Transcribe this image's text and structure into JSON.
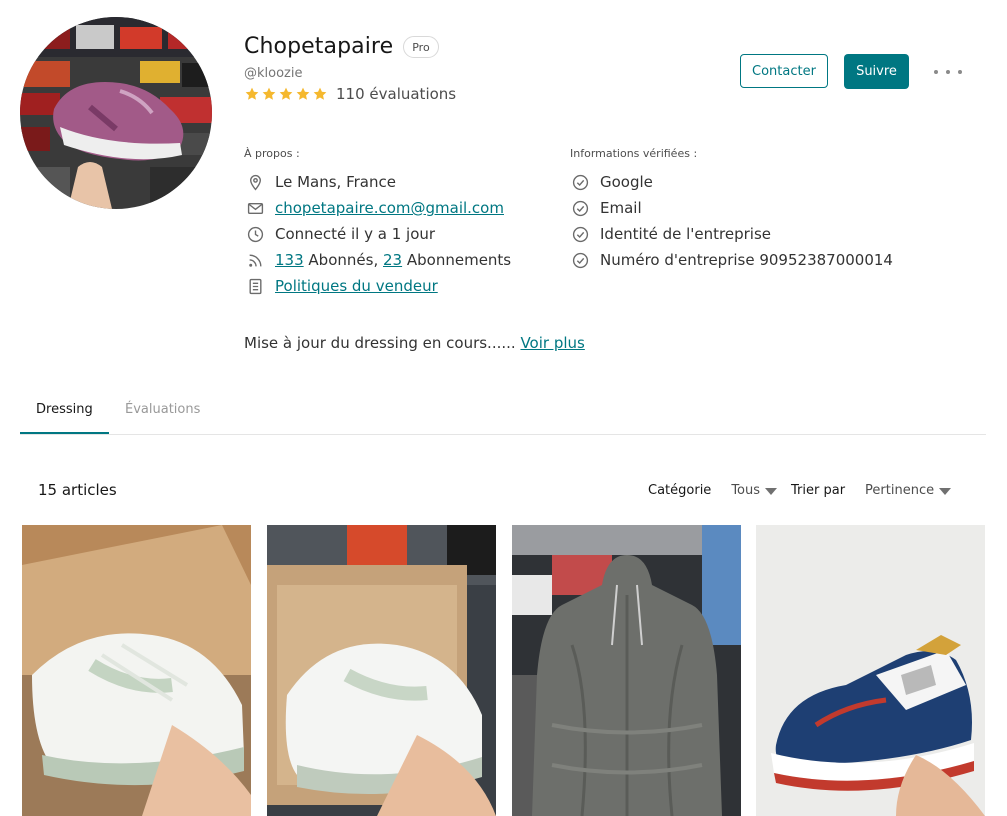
{
  "profile": {
    "name": "Chopetapaire",
    "badge": "Pro",
    "handle": "@kloozie",
    "rating_stars": 5,
    "rating_count_text": "110 évaluations",
    "avatar_description_icon": "avatar"
  },
  "actions": {
    "contact_label": "Contacter",
    "follow_label": "Suivre"
  },
  "about": {
    "label": "À propos :",
    "location": "Le Mans, France",
    "email": "chopetapaire.com@gmail.com",
    "last_seen": "Connecté il y a 1 jour",
    "followers_count": "133",
    "followers_label": "Abonnés,",
    "following_count": "23",
    "following_label": "Abonnements",
    "policies_link": "Politiques du vendeur"
  },
  "verified": {
    "label": "Informations vérifiées :",
    "items": [
      "Google",
      "Email",
      "Identité de l'entreprise",
      "Numéro d'entreprise 90952387000014"
    ]
  },
  "bio": {
    "text": "Mise à jour du dressing en cours......",
    "more_link": "Voir plus"
  },
  "tabs": [
    {
      "label": "Dressing",
      "active": true
    },
    {
      "label": "Évaluations",
      "active": false
    }
  ],
  "listing": {
    "count_text": "15 articles",
    "category_label": "Catégorie",
    "category_value": "Tous",
    "sort_label": "Trier par",
    "sort_value": "Pertinence"
  },
  "colors": {
    "accent": "#007782",
    "star": "#f5b82e"
  }
}
